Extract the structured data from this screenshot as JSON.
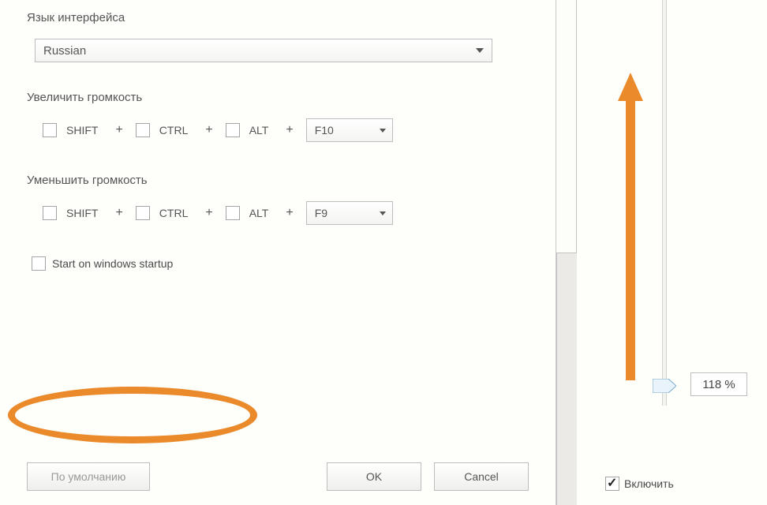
{
  "left": {
    "language_label": "Язык интерфейса",
    "language_value": "Russian",
    "volume_up_label": "Увеличить громкость",
    "volume_up_key": "F10",
    "volume_down_label": "Уменьшить громкость",
    "volume_down_key": "F9",
    "mod_shift": "SHIFT",
    "mod_ctrl": "CTRL",
    "mod_alt": "ALT",
    "plus": "+",
    "startup_label": "Start on windows startup",
    "btn_default": "По умолчанию",
    "btn_ok": "OK",
    "btn_cancel": "Cancel"
  },
  "right": {
    "value": "118 %",
    "enable_label": "Включить"
  }
}
